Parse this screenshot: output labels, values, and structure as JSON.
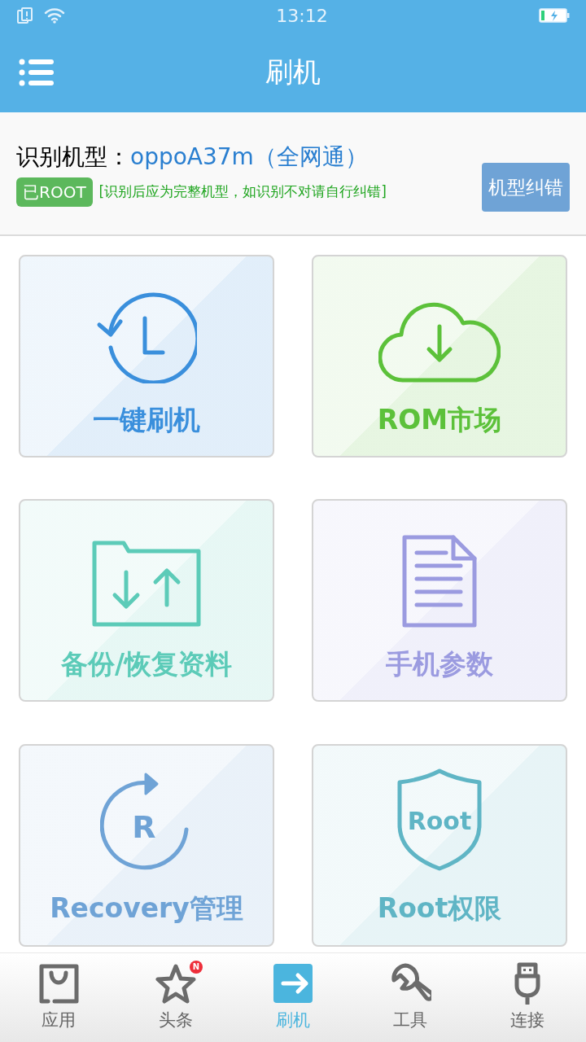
{
  "status_bar": {
    "time": "13:12"
  },
  "header": {
    "title": "刷机"
  },
  "device": {
    "label": "识别机型：",
    "model": "oppoA37m（全网通）",
    "root_badge": "已ROOT",
    "hint": "[识别后应为完整机型，如识别不对请自行纠错]",
    "fix_button": "机型纠错"
  },
  "tiles": [
    {
      "label": "一键刷机",
      "kind": "restore",
      "color": "#3a8fdc"
    },
    {
      "label": "ROM市场",
      "kind": "cloud",
      "color": "#5cc13a"
    },
    {
      "label": "备份/恢复资料",
      "kind": "folder",
      "color": "#5ccbb8"
    },
    {
      "label": "手机参数",
      "kind": "document",
      "color": "#9b9be0"
    },
    {
      "label": "Recovery管理",
      "kind": "recovery",
      "color": "#6fa3d6",
      "icon_text": "R"
    },
    {
      "label": "Root权限",
      "kind": "shield",
      "color": "#5fb5c5",
      "icon_text": "Root"
    }
  ],
  "tab_bar": [
    {
      "label": "应用",
      "kind": "bag",
      "selected": false
    },
    {
      "label": "头条",
      "kind": "star",
      "selected": false,
      "badge": "N"
    },
    {
      "label": "刷机",
      "kind": "arrow",
      "selected": true
    },
    {
      "label": "工具",
      "kind": "wrench",
      "selected": false
    },
    {
      "label": "连接",
      "kind": "plug",
      "selected": false
    }
  ]
}
